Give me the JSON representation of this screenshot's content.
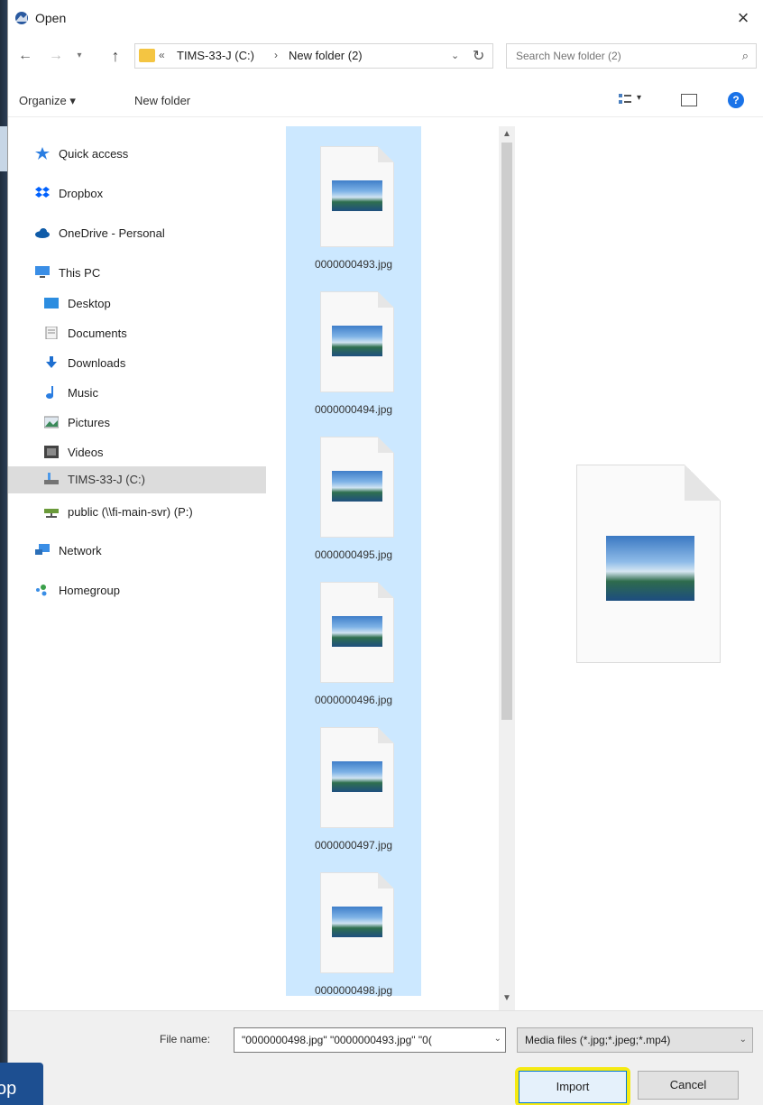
{
  "dialog": {
    "title": "Open",
    "close_glyph": "×"
  },
  "nav": {
    "back_glyph": "←",
    "forward_glyph": "→",
    "up_glyph": "↑",
    "breadcrumb": [
      "TIMS-33-J (C:)",
      "New folder (2)"
    ],
    "search_placeholder": "Search New folder (2)"
  },
  "toolbar": {
    "organize_label": "Organize ▾",
    "new_folder_label": "New folder",
    "help_glyph": "?"
  },
  "sidebar": {
    "items": [
      {
        "label": "Quick access",
        "icon": "star-icon"
      },
      {
        "label": "Dropbox",
        "icon": "dropbox-icon"
      },
      {
        "label": "OneDrive - Personal",
        "icon": "cloud-icon"
      },
      {
        "label": "This PC",
        "icon": "computer-icon"
      },
      {
        "label": "Desktop",
        "icon": "desktop-icon"
      },
      {
        "label": "Documents",
        "icon": "documents-icon"
      },
      {
        "label": "Downloads",
        "icon": "download-icon"
      },
      {
        "label": "Music",
        "icon": "music-icon"
      },
      {
        "label": "Pictures",
        "icon": "pictures-icon"
      },
      {
        "label": "Videos",
        "icon": "video-icon"
      },
      {
        "label": "TIMS-33-J (C:)",
        "icon": "drive-icon",
        "selected": true
      },
      {
        "label": "public (\\\\fi-main-svr) (P:)",
        "icon": "network-drive-icon"
      },
      {
        "label": "Network",
        "icon": "network-icon"
      },
      {
        "label": "Homegroup",
        "icon": "homegroup-icon"
      }
    ]
  },
  "files": [
    {
      "name": "0000000493.jpg"
    },
    {
      "name": "0000000494.jpg"
    },
    {
      "name": "0000000495.jpg"
    },
    {
      "name": "0000000496.jpg"
    },
    {
      "name": "0000000497.jpg"
    },
    {
      "name": "0000000498.jpg"
    }
  ],
  "bottom": {
    "file_name_label": "File name:",
    "file_name_value": "\"0000000498.jpg\" \"0000000493.jpg\" \"0(",
    "file_type_value": "Media files (*.jpg;*.jpeg;*.mp4)",
    "import_label": "Import",
    "cancel_label": "Cancel"
  },
  "taskbar_tag": "op",
  "colors": {
    "selection": "#cce8ff",
    "highlight": "#f5ea12",
    "accent": "#0078d7"
  }
}
